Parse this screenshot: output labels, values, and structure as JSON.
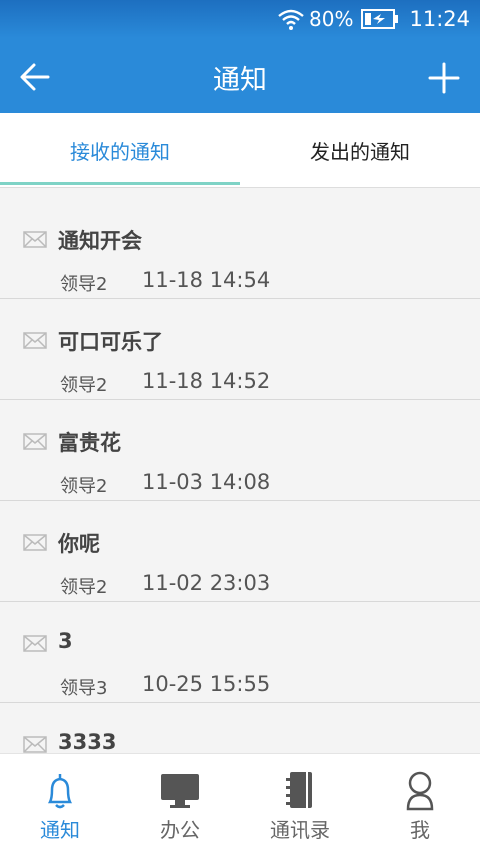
{
  "status_bar": {
    "battery": "80%",
    "time": "11:24"
  },
  "header": {
    "title": "通知"
  },
  "tabs": [
    {
      "label": "接收的通知",
      "active": true
    },
    {
      "label": "发出的通知",
      "active": false
    }
  ],
  "notifications": [
    {
      "subject": "通知开会",
      "sender": "领导2",
      "time": "11-18 14:54"
    },
    {
      "subject": "可口可乐了",
      "sender": "领导2",
      "time": "11-18 14:52"
    },
    {
      "subject": "富贵花",
      "sender": "领导2",
      "time": "11-03 14:08"
    },
    {
      "subject": "你呢",
      "sender": "领导2",
      "time": "11-02 23:03"
    },
    {
      "subject": "3",
      "sender": "领导3",
      "time": "10-25 15:55"
    },
    {
      "subject": "3333",
      "sender": "",
      "time": ""
    }
  ],
  "bottom_nav": [
    {
      "label": "通知",
      "icon": "bell-icon",
      "active": true
    },
    {
      "label": "办公",
      "icon": "monitor-icon",
      "active": false
    },
    {
      "label": "通讯录",
      "icon": "contacts-book-icon",
      "active": false
    },
    {
      "label": "我",
      "icon": "person-icon",
      "active": false
    }
  ],
  "colors": {
    "primary": "#2a8ad9",
    "tab_indicator": "#7fd3c6"
  }
}
